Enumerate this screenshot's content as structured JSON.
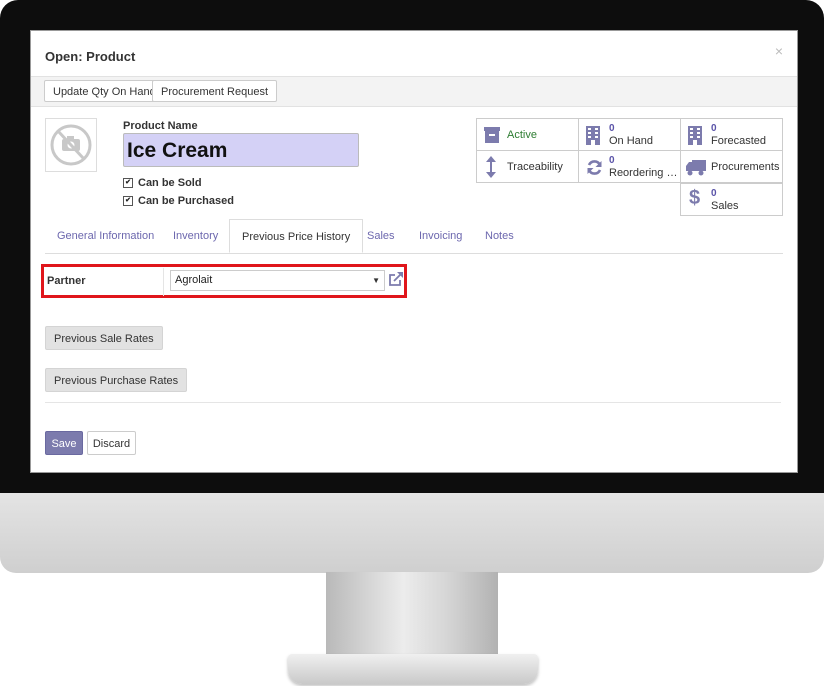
{
  "modal": {
    "title": "Open: Product",
    "close": "×"
  },
  "header_buttons": [
    "Update Qty On Hand",
    "Procurement Request"
  ],
  "product": {
    "name_label": "Product Name",
    "name": "Ice Cream",
    "can_be_sold": "Can be Sold",
    "can_be_purchased": "Can be Purchased"
  },
  "smart_buttons": {
    "active": {
      "label": "Active",
      "icon": "archive-icon",
      "color": "#2e7d32"
    },
    "on_hand": {
      "value": "0",
      "label": "On Hand",
      "icon": "building-icon"
    },
    "forecasted": {
      "value": "0",
      "label": "Forecasted",
      "icon": "building-icon"
    },
    "traceability": {
      "label": "Traceability",
      "icon": "arrows-vertical-icon"
    },
    "reordering": {
      "value": "0",
      "label": "Reordering R...",
      "icon": "refresh-icon"
    },
    "procurements": {
      "label": "Procurements",
      "icon": "truck-icon"
    },
    "sales": {
      "value": "0",
      "label": "Sales",
      "icon": "dollar-icon"
    }
  },
  "tabs": [
    "General Information",
    "Inventory",
    "Previous Price History",
    "Sales",
    "Invoicing",
    "Notes"
  ],
  "active_tab": "Previous Price History",
  "partner": {
    "label": "Partner",
    "value": "Agrolait"
  },
  "rate_buttons": {
    "sale": "Previous Sale Rates",
    "purchase": "Previous Purchase Rates"
  },
  "footer": {
    "save": "Save",
    "discard": "Discard"
  },
  "colors": {
    "accent": "#7c7bad",
    "highlight": "#e0161b",
    "name_field": "#d4d1f6"
  }
}
